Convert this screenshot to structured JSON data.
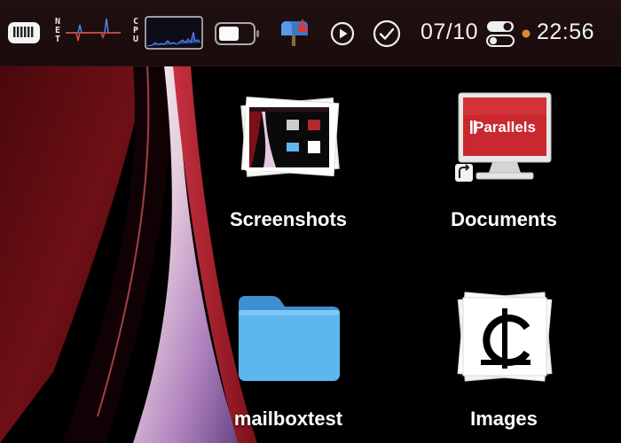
{
  "menubar": {
    "net_label": "NET",
    "cpu_label": "CPU",
    "date": "07/10",
    "time": "22:56",
    "status_dot_color": "#d88a3a",
    "icons": [
      "ram-icon",
      "net-graph-icon",
      "cpu-graph-icon",
      "battery-icon",
      "mailbox-icon",
      "play-icon",
      "checkmark-icon",
      "toggle-switches-icon"
    ]
  },
  "desktop": {
    "icons": [
      {
        "label": "Screenshots",
        "icon": "screenshots-stack-icon"
      },
      {
        "label": "Documents",
        "icon": "parallels-alias-icon"
      },
      {
        "label": "mailboxtest",
        "icon": "folder-icon"
      },
      {
        "label": "Images",
        "icon": "images-stack-icon"
      }
    ],
    "parallels_text": "Parallels"
  },
  "colors": {
    "menubar_bg": "#1e0e10",
    "folder_blue": "#5eb6ef",
    "wallpaper_red": "#6a0e14"
  }
}
